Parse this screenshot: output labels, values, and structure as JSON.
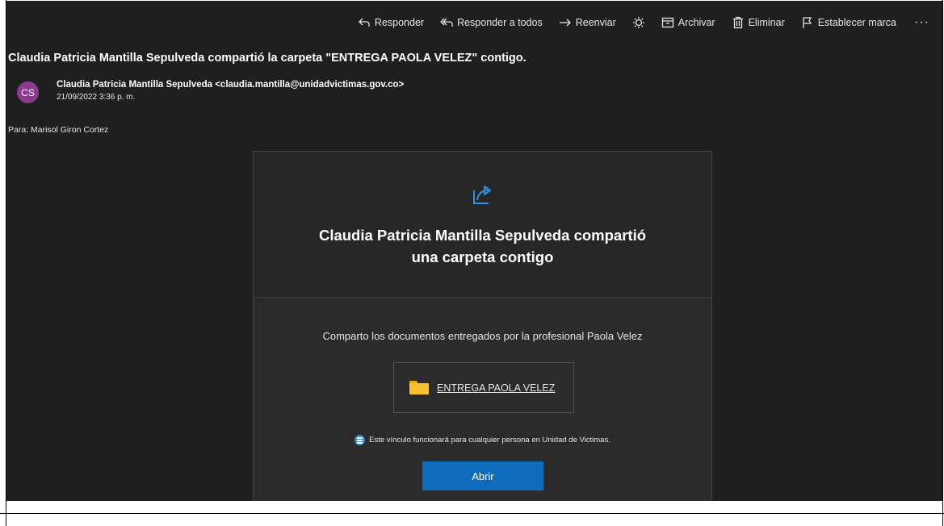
{
  "toolbar": {
    "reply": "Responder",
    "reply_all": "Responder a todos",
    "forward": "Reenviar",
    "archive": "Archivar",
    "delete": "Eliminar",
    "flag": "Establecer marca",
    "more": "···"
  },
  "email": {
    "subject": "Claudia Patricia Mantilla Sepulveda compartió la carpeta \"ENTREGA PAOLA VELEZ\" contigo.",
    "avatar_initials": "CS",
    "avatar_color": "#8b3a8e",
    "sender": "Claudia Patricia Mantilla Sepulveda <claudia.mantilla@unidadvictimas.gov.co>",
    "date": "21/09/2022 3:36 p. m.",
    "to": "Para: Marisol Giron Cortez"
  },
  "card": {
    "title_line1": "Claudia Patricia Mantilla Sepulveda compartió",
    "title_line2": "una carpeta contigo",
    "message": "Comparto los documentos entregados por la profesional Paola Velez",
    "folder_name": "ENTREGA PAOLA VELEZ",
    "notice": "Este vínculo funcionará para cualquier persona en Unidad de Victimas.",
    "open_button": "Abrir",
    "accent_color": "#2f8fe3",
    "button_color": "#0f6cbd"
  }
}
